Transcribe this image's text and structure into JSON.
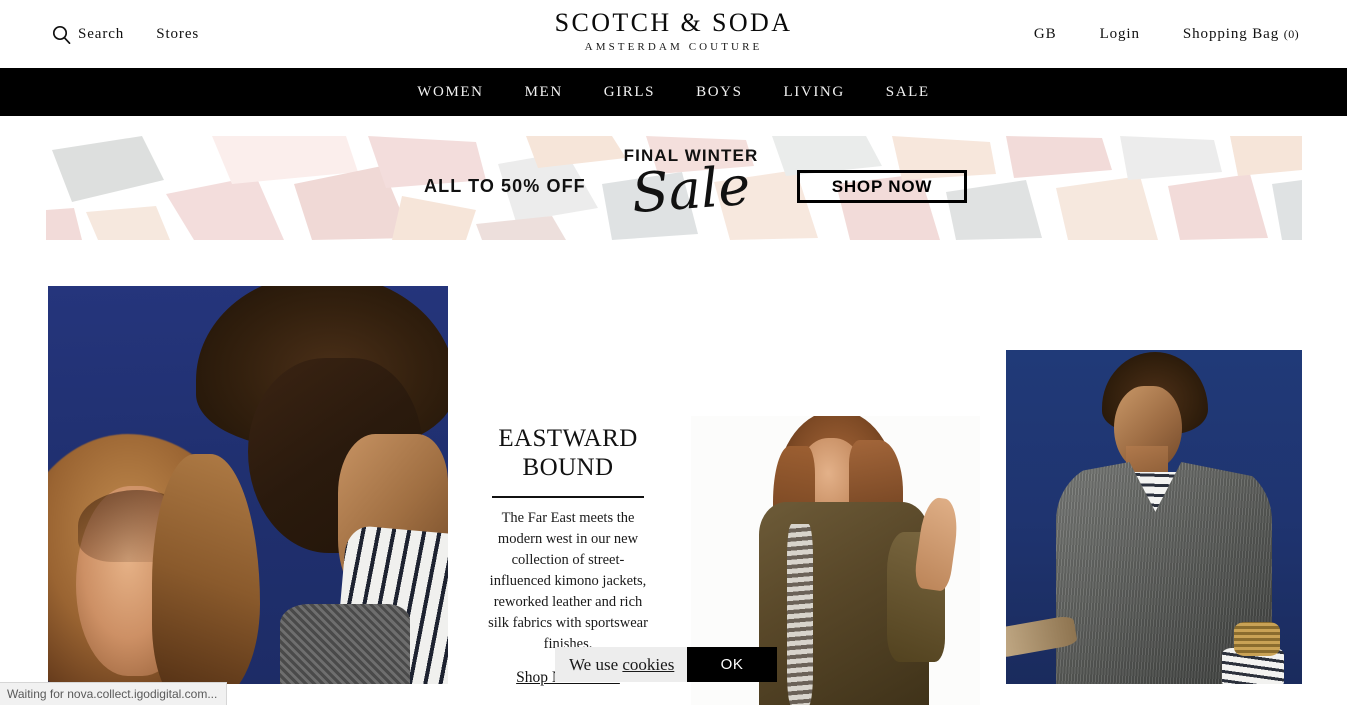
{
  "header": {
    "search_label": "Search",
    "search_icon": "search-icon",
    "stores_label": "Stores",
    "logo_main": "SCOTCH & SODA",
    "logo_sub": "AMSTERDAM COUTURE",
    "region_label": "GB",
    "login_label": "Login",
    "bag_label": "Shopping Bag",
    "bag_count": "(0)"
  },
  "nav": {
    "items": [
      {
        "label": "WOMEN"
      },
      {
        "label": "MEN"
      },
      {
        "label": "GIRLS"
      },
      {
        "label": "BOYS"
      },
      {
        "label": "LIVING"
      },
      {
        "label": "SALE"
      }
    ]
  },
  "promo": {
    "discount": "ALL TO 50% OFF",
    "headline": "FINAL WINTER",
    "script_word": "Sale",
    "cta_label": "SHOP NOW",
    "colors": {
      "pink": "#f3dcdb",
      "grey": "#dcdedd",
      "peach": "#f6e4d8",
      "background": "#ffffff"
    }
  },
  "editorial": {
    "title": "EASTWARD BOUND",
    "body": "The Far East meets the modern west in our new collection of street-influenced kimono jackets, reworked leather and rich silk fabrics with sportswear finishes.",
    "link_label": "Shop New In for"
  },
  "cookie": {
    "text_prefix": "We use ",
    "link_label": "cookies",
    "ok_label": "OK"
  },
  "status": {
    "message": "Waiting for nova.collect.igodigital.com..."
  }
}
